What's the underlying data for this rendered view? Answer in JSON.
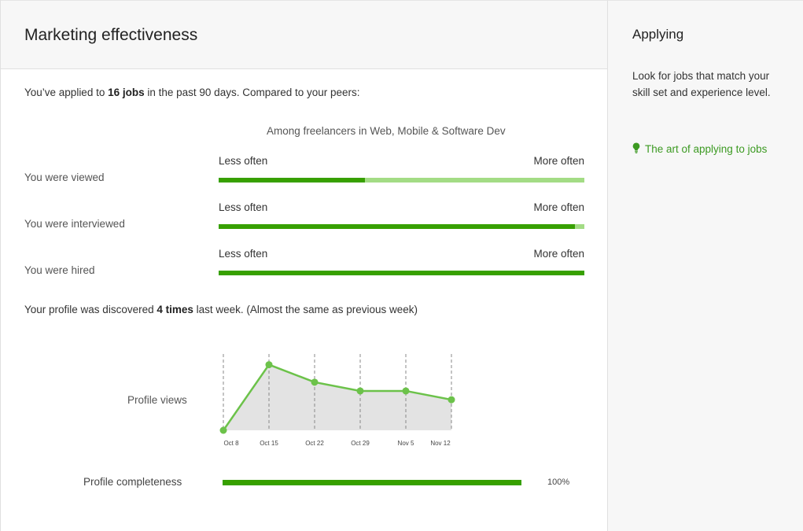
{
  "main": {
    "title": "Marketing effectiveness",
    "summary": {
      "prefix": "You’ve applied to ",
      "jobs": "16 jobs",
      "suffix": " in the past 90 days. Compared to your peers:"
    },
    "peer_group": "Among freelancers in Web, Mobile & Software Dev",
    "scale": {
      "less": "Less often",
      "more": "More often"
    },
    "metrics": [
      {
        "label": "You were viewed",
        "fill_percent": 40
      },
      {
        "label": "You were interviewed",
        "fill_percent": 97.5
      },
      {
        "label": "You were hired",
        "fill_percent": 100
      }
    ],
    "discovery": {
      "prefix": "Your profile was discovered ",
      "count": "4 times",
      "suffix": " last week. (Almost the same as previous week)"
    },
    "profile_views_label": "Profile views",
    "profile_completeness": {
      "label": "Profile completeness",
      "percent_text": "100%",
      "value": 100
    }
  },
  "chart_data": {
    "type": "area",
    "categories": [
      "Oct 8",
      "Oct 15",
      "Oct 22",
      "Oct 29",
      "Nov 5",
      "Nov 12"
    ],
    "values": [
      0,
      7.5,
      5.5,
      4.5,
      4.5,
      3.5
    ],
    "ylim": [
      0,
      8
    ],
    "grid": "vertical-dashed",
    "colors": {
      "line": "#6cc24a",
      "area": "#e3e3e3",
      "grid": "#888888"
    }
  },
  "sidebar": {
    "title": "Applying",
    "description": "Look for jobs that match your skill set and experience level.",
    "link": {
      "icon": "lightbulb-icon",
      "label": "The art of applying to jobs"
    }
  },
  "colors": {
    "accent": "#37a000",
    "accent_light": "#a3dc85",
    "link": "#3c9a22"
  }
}
